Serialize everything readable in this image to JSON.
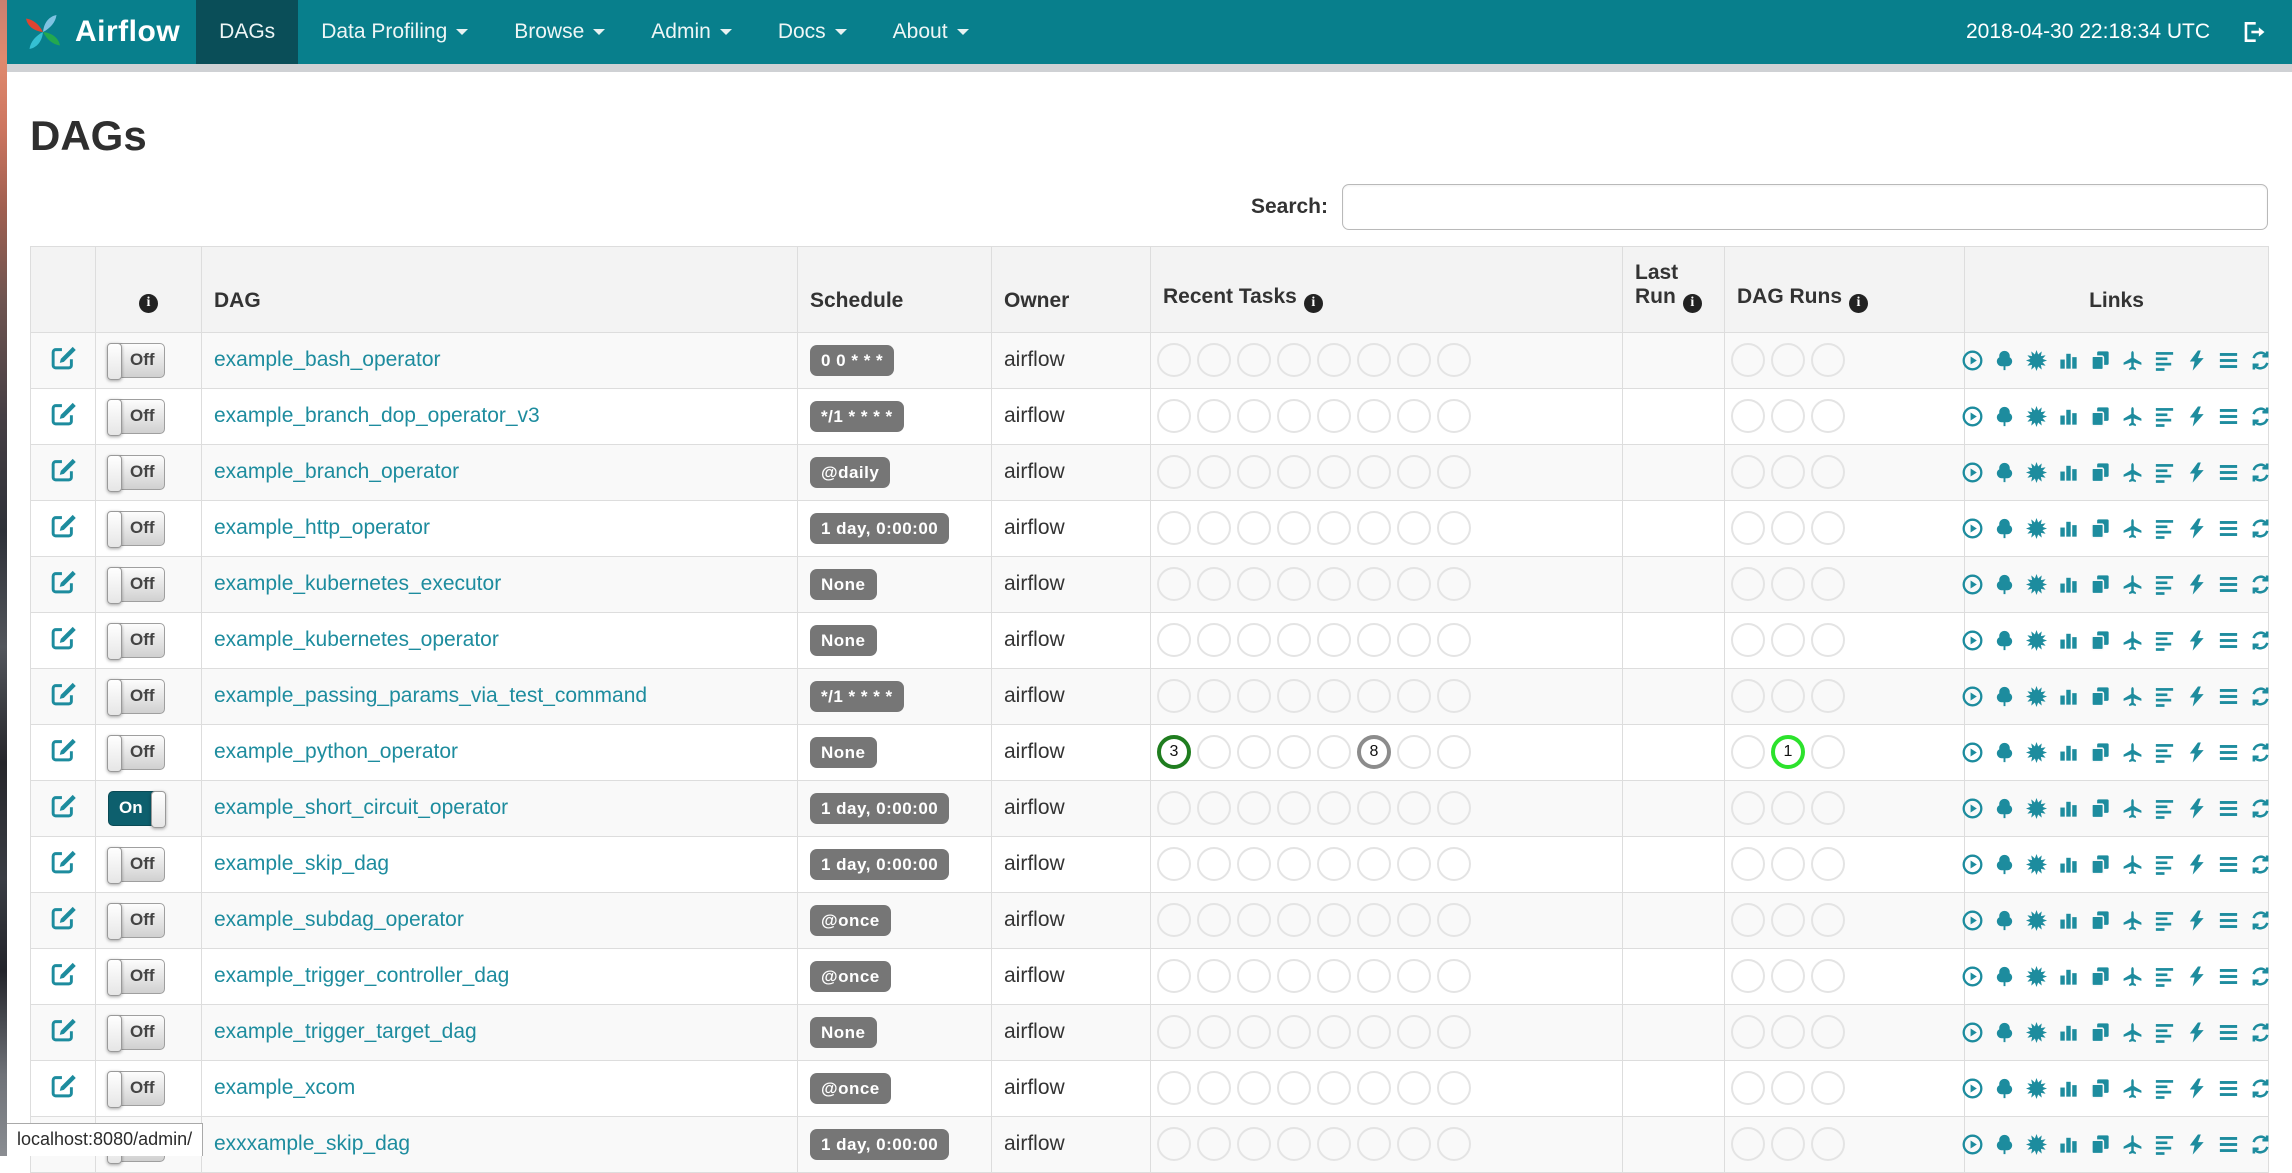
{
  "navbar": {
    "brand": "Airflow",
    "items": [
      {
        "label": "DAGs",
        "active": true,
        "caret": false
      },
      {
        "label": "Data Profiling",
        "active": false,
        "caret": true
      },
      {
        "label": "Browse",
        "active": false,
        "caret": true
      },
      {
        "label": "Admin",
        "active": false,
        "caret": true
      },
      {
        "label": "Docs",
        "active": false,
        "caret": true
      },
      {
        "label": "About",
        "active": false,
        "caret": true
      }
    ],
    "clock": "2018-04-30 22:18:34 UTC",
    "signout_icon": "sign-out-icon",
    "colors": {
      "background": "#087f8c",
      "active_item": "#0a4e58"
    }
  },
  "page": {
    "title": "DAGs"
  },
  "search": {
    "label": "Search:",
    "value": ""
  },
  "table": {
    "headers": {
      "info_icon": "info-icon",
      "dag": "DAG",
      "schedule": "Schedule",
      "owner": "Owner",
      "recent_tasks": "Recent Tasks",
      "last_run_line1": "Last",
      "last_run_line2": "Run",
      "dag_runs": "DAG Runs",
      "links": "Links"
    },
    "recent_task_slots": 8,
    "dag_run_slots": 3,
    "link_icons": [
      "play-circle",
      "tree",
      "sunburst",
      "bar-chart",
      "copy",
      "plane",
      "align-left",
      "bolt",
      "menu",
      "refresh"
    ],
    "state_colors": {
      "success": "#1f7d1f",
      "queued_gray": "#8c8c8c",
      "running_green": "#2ce22c",
      "empty_border": "#e4e4e4"
    },
    "rows": [
      {
        "name": "example_bash_operator",
        "toggle": "Off",
        "schedule": "0 0 * * *",
        "owner": "airflow",
        "last_run": "",
        "recent_tasks": {},
        "dag_runs": {}
      },
      {
        "name": "example_branch_dop_operator_v3",
        "toggle": "Off",
        "schedule": "*/1 * * * *",
        "owner": "airflow",
        "last_run": "",
        "recent_tasks": {},
        "dag_runs": {}
      },
      {
        "name": "example_branch_operator",
        "toggle": "Off",
        "schedule": "@daily",
        "owner": "airflow",
        "last_run": "",
        "recent_tasks": {},
        "dag_runs": {}
      },
      {
        "name": "example_http_operator",
        "toggle": "Off",
        "schedule": "1 day, 0:00:00",
        "owner": "airflow",
        "last_run": "",
        "recent_tasks": {},
        "dag_runs": {}
      },
      {
        "name": "example_kubernetes_executor",
        "toggle": "Off",
        "schedule": "None",
        "owner": "airflow",
        "last_run": "",
        "recent_tasks": {},
        "dag_runs": {}
      },
      {
        "name": "example_kubernetes_operator",
        "toggle": "Off",
        "schedule": "None",
        "owner": "airflow",
        "last_run": "",
        "recent_tasks": {},
        "dag_runs": {}
      },
      {
        "name": "example_passing_params_via_test_command",
        "toggle": "Off",
        "schedule": "*/1 * * * *",
        "owner": "airflow",
        "last_run": "",
        "recent_tasks": {},
        "dag_runs": {}
      },
      {
        "name": "example_python_operator",
        "toggle": "Off",
        "schedule": "None",
        "owner": "airflow",
        "last_run": "",
        "recent_tasks": {
          "0": {
            "count": "3",
            "color": "#1f7d1f"
          },
          "5": {
            "count": "8",
            "color": "#8c8c8c"
          }
        },
        "dag_runs": {
          "1": {
            "count": "1",
            "color": "#2ce22c"
          }
        }
      },
      {
        "name": "example_short_circuit_operator",
        "toggle": "On",
        "schedule": "1 day, 0:00:00",
        "owner": "airflow",
        "last_run": "",
        "recent_tasks": {},
        "dag_runs": {}
      },
      {
        "name": "example_skip_dag",
        "toggle": "Off",
        "schedule": "1 day, 0:00:00",
        "owner": "airflow",
        "last_run": "",
        "recent_tasks": {},
        "dag_runs": {}
      },
      {
        "name": "example_subdag_operator",
        "toggle": "Off",
        "schedule": "@once",
        "owner": "airflow",
        "last_run": "",
        "recent_tasks": {},
        "dag_runs": {}
      },
      {
        "name": "example_trigger_controller_dag",
        "toggle": "Off",
        "schedule": "@once",
        "owner": "airflow",
        "last_run": "",
        "recent_tasks": {},
        "dag_runs": {}
      },
      {
        "name": "example_trigger_target_dag",
        "toggle": "Off",
        "schedule": "None",
        "owner": "airflow",
        "last_run": "",
        "recent_tasks": {},
        "dag_runs": {}
      },
      {
        "name": "example_xcom",
        "toggle": "Off",
        "schedule": "@once",
        "owner": "airflow",
        "last_run": "",
        "recent_tasks": {},
        "dag_runs": {}
      },
      {
        "name": "exxxample_skip_dag",
        "toggle": "Off",
        "schedule": "1 day, 0:00:00",
        "owner": "airflow",
        "last_run": "",
        "recent_tasks": {},
        "dag_runs": {}
      }
    ]
  },
  "statusbar": {
    "text": "localhost:8080/admin/"
  }
}
